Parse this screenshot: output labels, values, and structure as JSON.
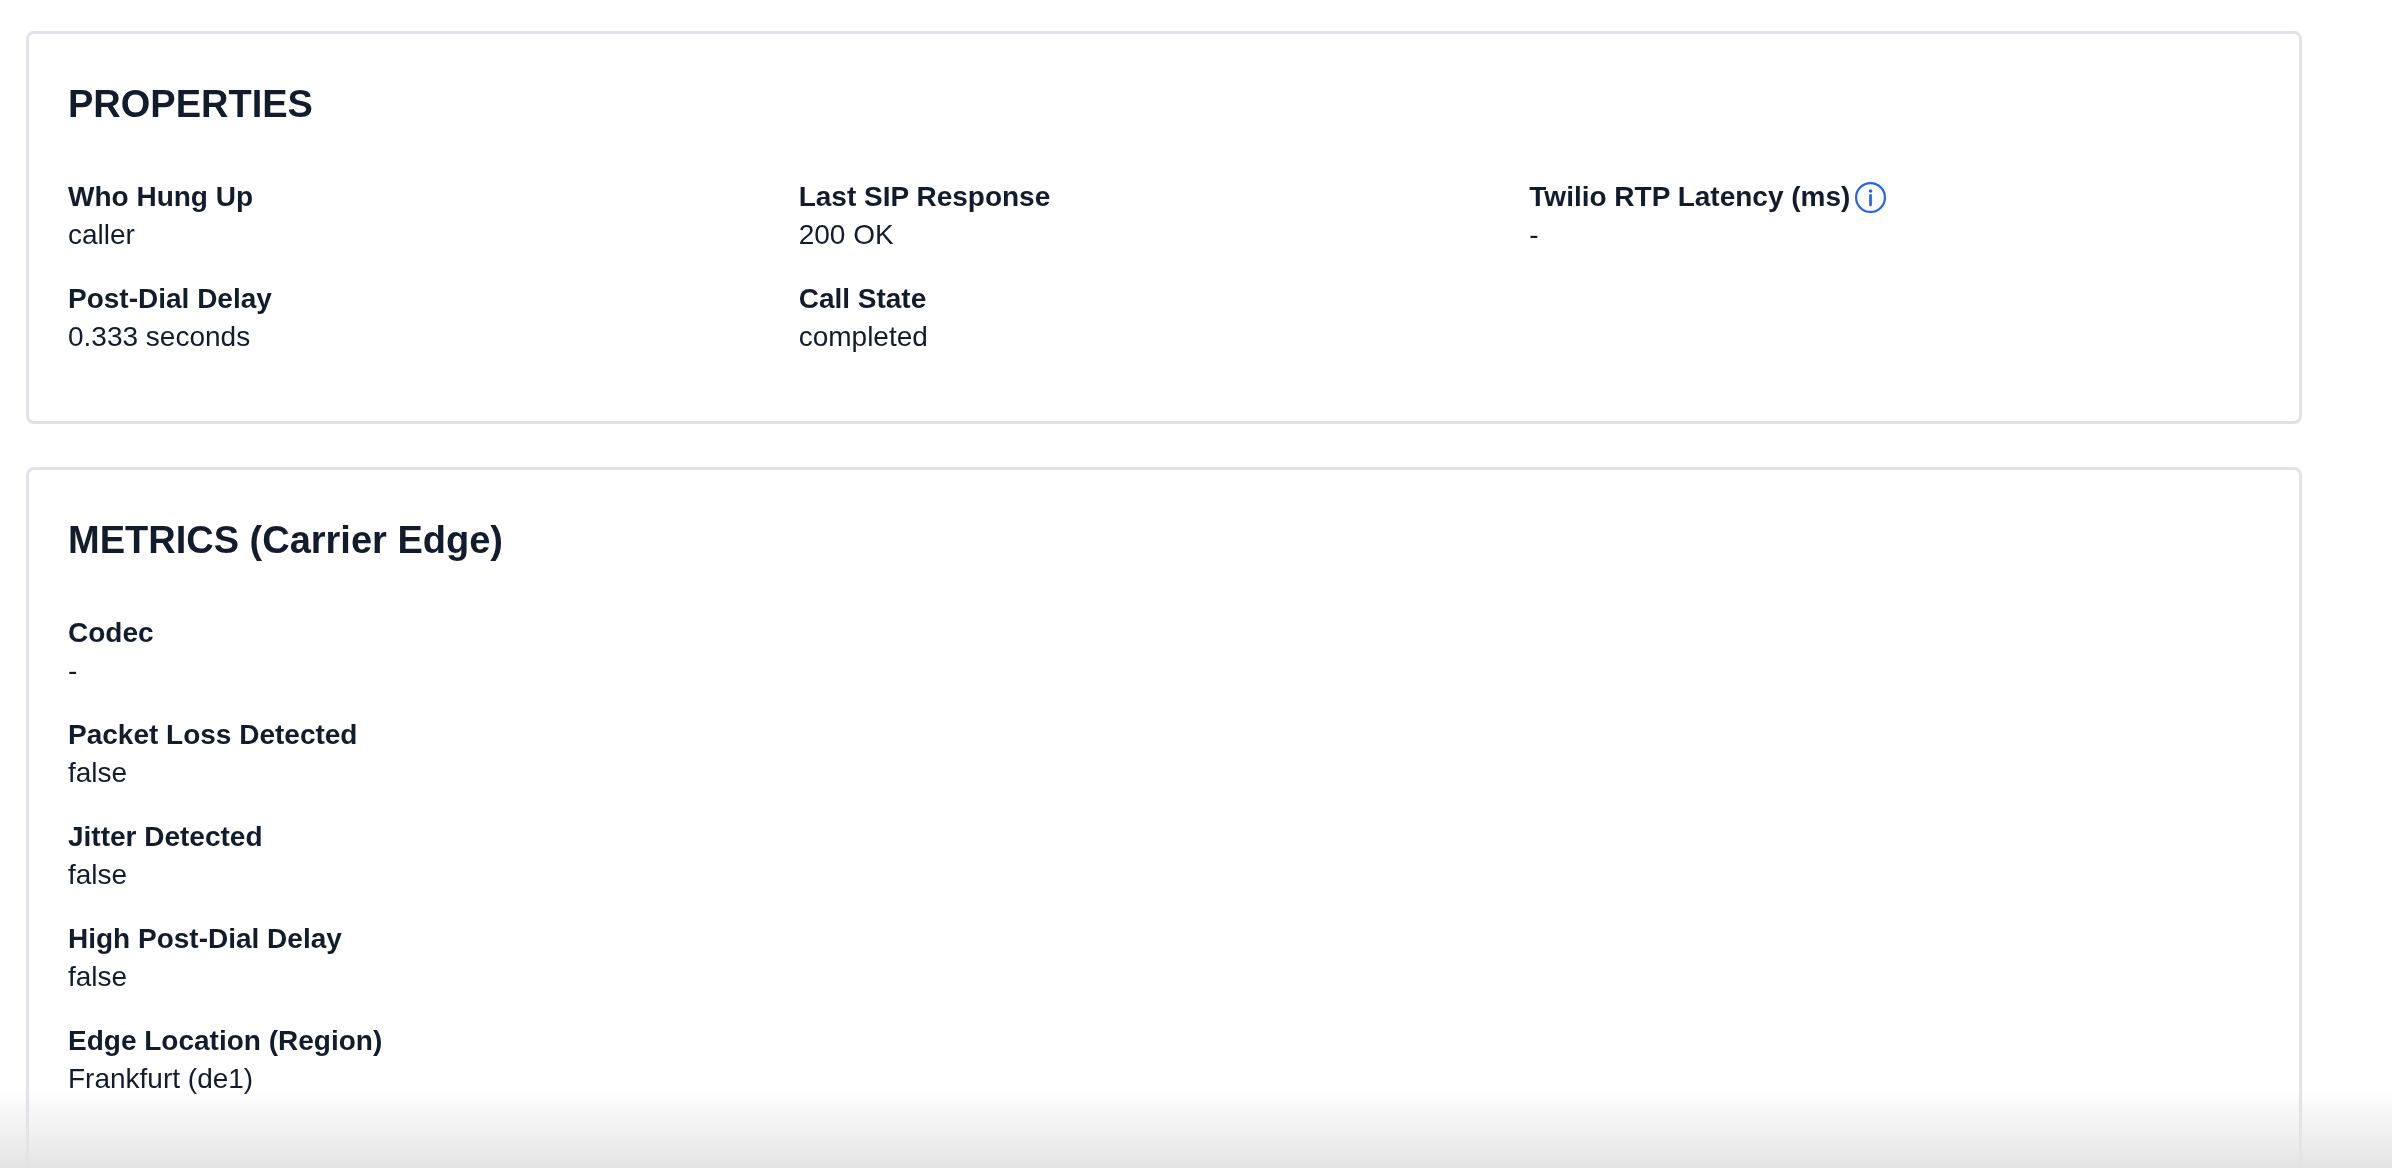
{
  "sections": [
    {
      "kind": "grid",
      "title": "PROPERTIES",
      "items": [
        {
          "label": "Who Hung Up",
          "value": "caller"
        },
        {
          "label": "Last SIP Response",
          "value": "200 OK"
        },
        {
          "label": "Twilio RTP Latency (ms)",
          "value": "-",
          "info": true
        },
        {
          "label": "Post-Dial Delay",
          "value": "0.333 seconds"
        },
        {
          "label": "Call State",
          "value": "completed"
        }
      ]
    },
    {
      "kind": "list",
      "title": "METRICS (Carrier Edge)",
      "items": [
        {
          "label": "Codec",
          "value": "-"
        },
        {
          "label": "Packet Loss Detected",
          "value": "false"
        },
        {
          "label": "Jitter Detected",
          "value": "false"
        },
        {
          "label": "High Post-Dial Delay",
          "value": "false"
        },
        {
          "label": "Edge Location (Region)",
          "value": "Frankfurt (de1)"
        }
      ]
    }
  ]
}
